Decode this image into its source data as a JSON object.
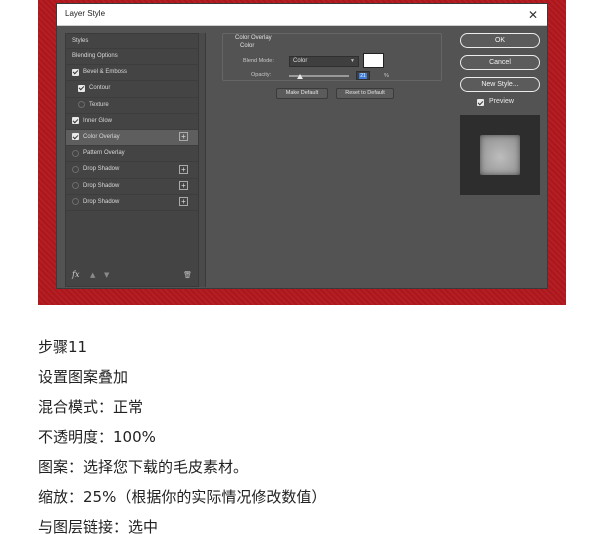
{
  "dialog": {
    "title": "Layer Style",
    "styles_list": {
      "header": "Styles",
      "items": [
        {
          "label": "Blending Options",
          "checkbox": "none",
          "indent": 0,
          "active": false,
          "plus": false
        },
        {
          "label": "Bevel & Emboss",
          "checkbox": "on",
          "indent": 0,
          "active": false,
          "plus": false
        },
        {
          "label": "Contour",
          "checkbox": "on",
          "indent": 1,
          "active": false,
          "plus": false
        },
        {
          "label": "Texture",
          "checkbox": "off",
          "indent": 1,
          "active": false,
          "plus": false
        },
        {
          "label": "Inner Glow",
          "checkbox": "on",
          "indent": 0,
          "active": false,
          "plus": false
        },
        {
          "label": "Color Overlay",
          "checkbox": "on",
          "indent": 0,
          "active": true,
          "plus": true
        },
        {
          "label": "Pattern Overlay",
          "checkbox": "off",
          "indent": 0,
          "active": false,
          "plus": false
        },
        {
          "label": "Drop Shadow",
          "checkbox": "off",
          "indent": 0,
          "active": false,
          "plus": true
        },
        {
          "label": "Drop Shadow",
          "checkbox": "off",
          "indent": 0,
          "active": false,
          "plus": true
        },
        {
          "label": "Drop Shadow",
          "checkbox": "off",
          "indent": 0,
          "active": false,
          "plus": true
        }
      ],
      "footer": {
        "fx": "fx"
      }
    },
    "color_overlay": {
      "group_title": "Color Overlay",
      "sub_title": "Color",
      "blend_mode_label": "Blend Mode:",
      "blend_mode_value": "Color",
      "overlay_color": "#ffffff",
      "opacity_label": "Opacity:",
      "opacity_value": "21",
      "opacity_unit": "%",
      "make_default": "Make Default",
      "reset_default": "Reset to Default"
    },
    "buttons": {
      "ok": "OK",
      "cancel": "Cancel",
      "new_style": "New Style..."
    },
    "preview_label": "Preview",
    "preview_checked": true
  },
  "caption": {
    "lines": [
      "步骤11",
      "设置图案叠加",
      "混合模式：正常",
      "不透明度：100%",
      "图案：选择您下载的毛皮素材。",
      "缩放：25%（根据你的实际情况修改数值）",
      "与图层链接：选中"
    ]
  },
  "colors": {
    "background_red": "#b1181d",
    "dialog_bg": "#535353",
    "selection_blue": "#3d7cd9"
  }
}
